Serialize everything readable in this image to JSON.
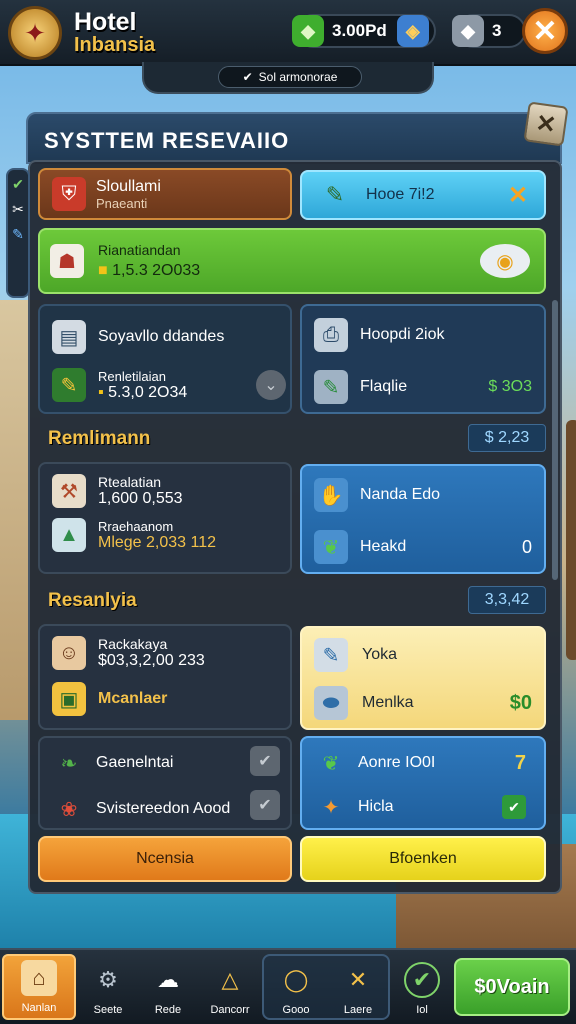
{
  "topbar": {
    "title_line1": "Hotel",
    "title_line2": "Inbansia",
    "currency_1": "3.00Pd",
    "currency_2": "3",
    "subpill_text": "Sol armonorae"
  },
  "panel": {
    "title": "SYSTTEM RESEVAIIO"
  },
  "row1": {
    "left_title": "Sloullami",
    "left_sub": "Pnaeanti",
    "right_label": "Hooe 7i!2"
  },
  "row2": {
    "title": "Rianatiandan",
    "value": "1,5.3 2O033"
  },
  "row3": {
    "left_title": "Soyavllo ddandes",
    "left_sub_title": "Renletilaian",
    "left_sub_value": "5.3,0 2O34",
    "right_top": "Hoopdi 2iok",
    "right_bottom": "Flaqlie",
    "right_bottom_value": "$ 3O3"
  },
  "section1": {
    "title": "Remlimann",
    "value": "$ 2,23"
  },
  "row4": {
    "left_a_title": "Rtealatian",
    "left_a_value": "1,600 0,553",
    "left_b_title": "Rraehaanom",
    "left_b_value": "Mlege 2,033 112",
    "right_top": "Nanda Edo",
    "right_bottom": "Heakd",
    "right_bottom_value": "0"
  },
  "section2": {
    "title": "Resanlyia",
    "value": "3,3,42"
  },
  "row5": {
    "left_title": "Rackakaya",
    "left_value": "$03,3,2,00 233",
    "left_b_title": "Mcanlaer",
    "right_top": "Yoka",
    "right_bottom": "Menlka",
    "right_bottom_value": "$0"
  },
  "row6": {
    "left_a": "Gaenelntai",
    "left_b": "Svistereedon Aood",
    "right_top": "Aonre IO0I",
    "right_top_value": "7",
    "right_bottom": "Hicla"
  },
  "buttons": {
    "orange": "Ncensia",
    "yellow": "Bfoenken"
  },
  "nav": {
    "items": [
      "Nanlan",
      "Seete",
      "Rede",
      "Dancorr",
      "Gooo",
      "Laere",
      "Iol"
    ],
    "cta": "$0Voain"
  }
}
